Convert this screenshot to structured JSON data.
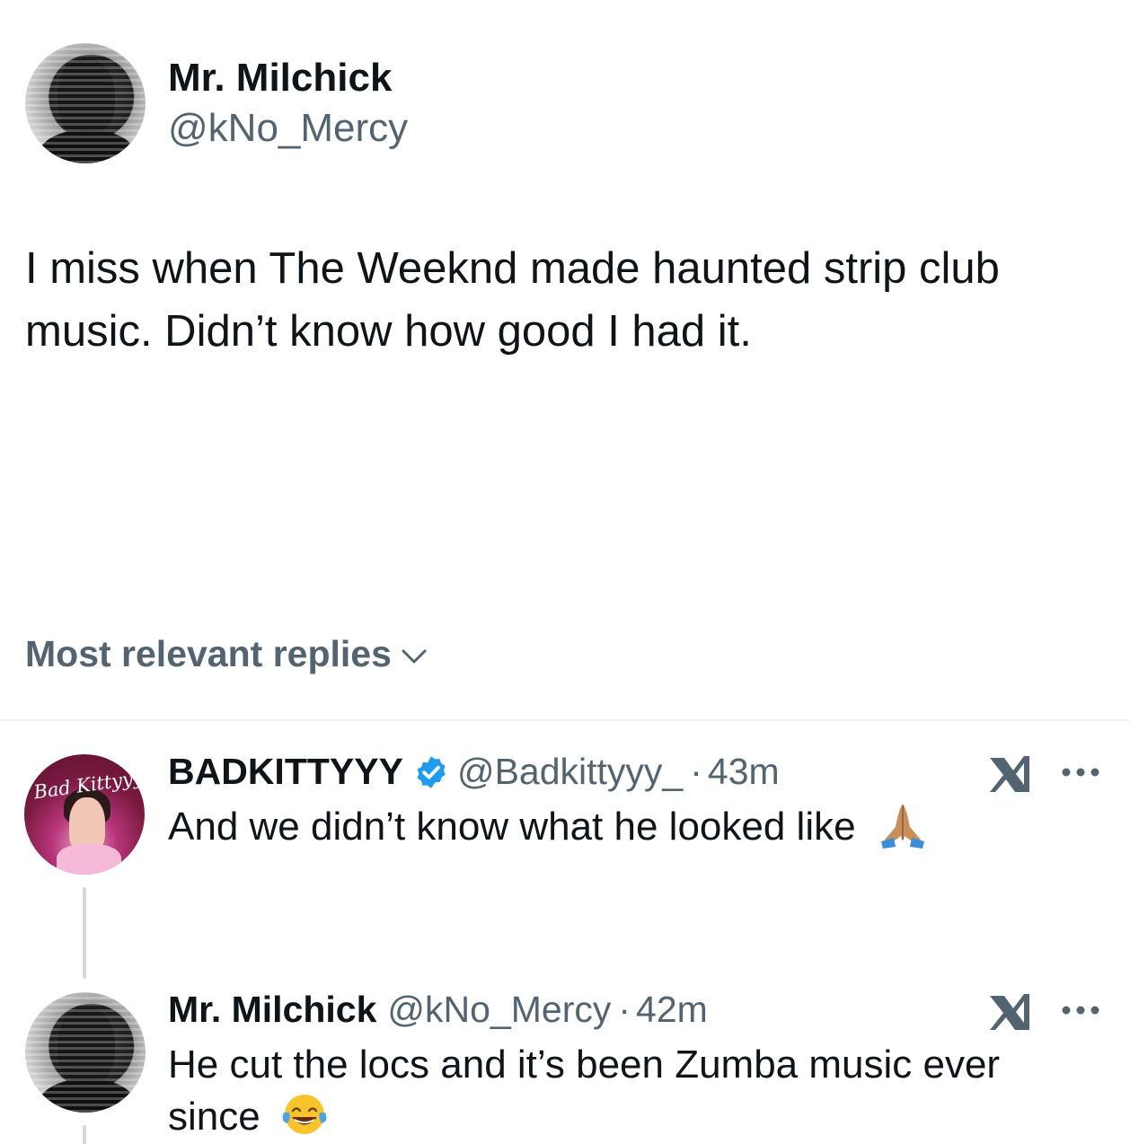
{
  "main_tweet": {
    "display_name": "Mr. Milchick",
    "handle": "@kNo_Mercy",
    "text_line1": "I miss when The Weeknd made haunted strip club",
    "text_line2": "music. Didn’t know how good I had it."
  },
  "replies_sort": {
    "label": "Most relevant replies",
    "icon": "chevron-down-icon"
  },
  "replies": [
    {
      "display_name": "BADKITTYYY",
      "verified": true,
      "handle": "@Badkittyyy_",
      "separator": "·",
      "time": "43m",
      "text": "And we didn’t know what he looked like",
      "emoji": "folded-hands",
      "avatar_script": "Bad Kittyyy",
      "grok_icon": "grok-icon",
      "more_icon": "more-options-icon"
    },
    {
      "display_name": "Mr. Milchick",
      "verified": false,
      "handle": "@kNo_Mercy",
      "separator": "·",
      "time": "42m",
      "text": "He cut the locs and it’s been Zumba music ever since",
      "emoji": "face-with-tears-of-joy",
      "grok_icon": "grok-icon",
      "more_icon": "more-options-icon"
    }
  ],
  "colors": {
    "primary_text": "#0f1419",
    "secondary_text": "#536471",
    "verified_blue": "#1d9bf0",
    "divider": "#eff3f4"
  }
}
